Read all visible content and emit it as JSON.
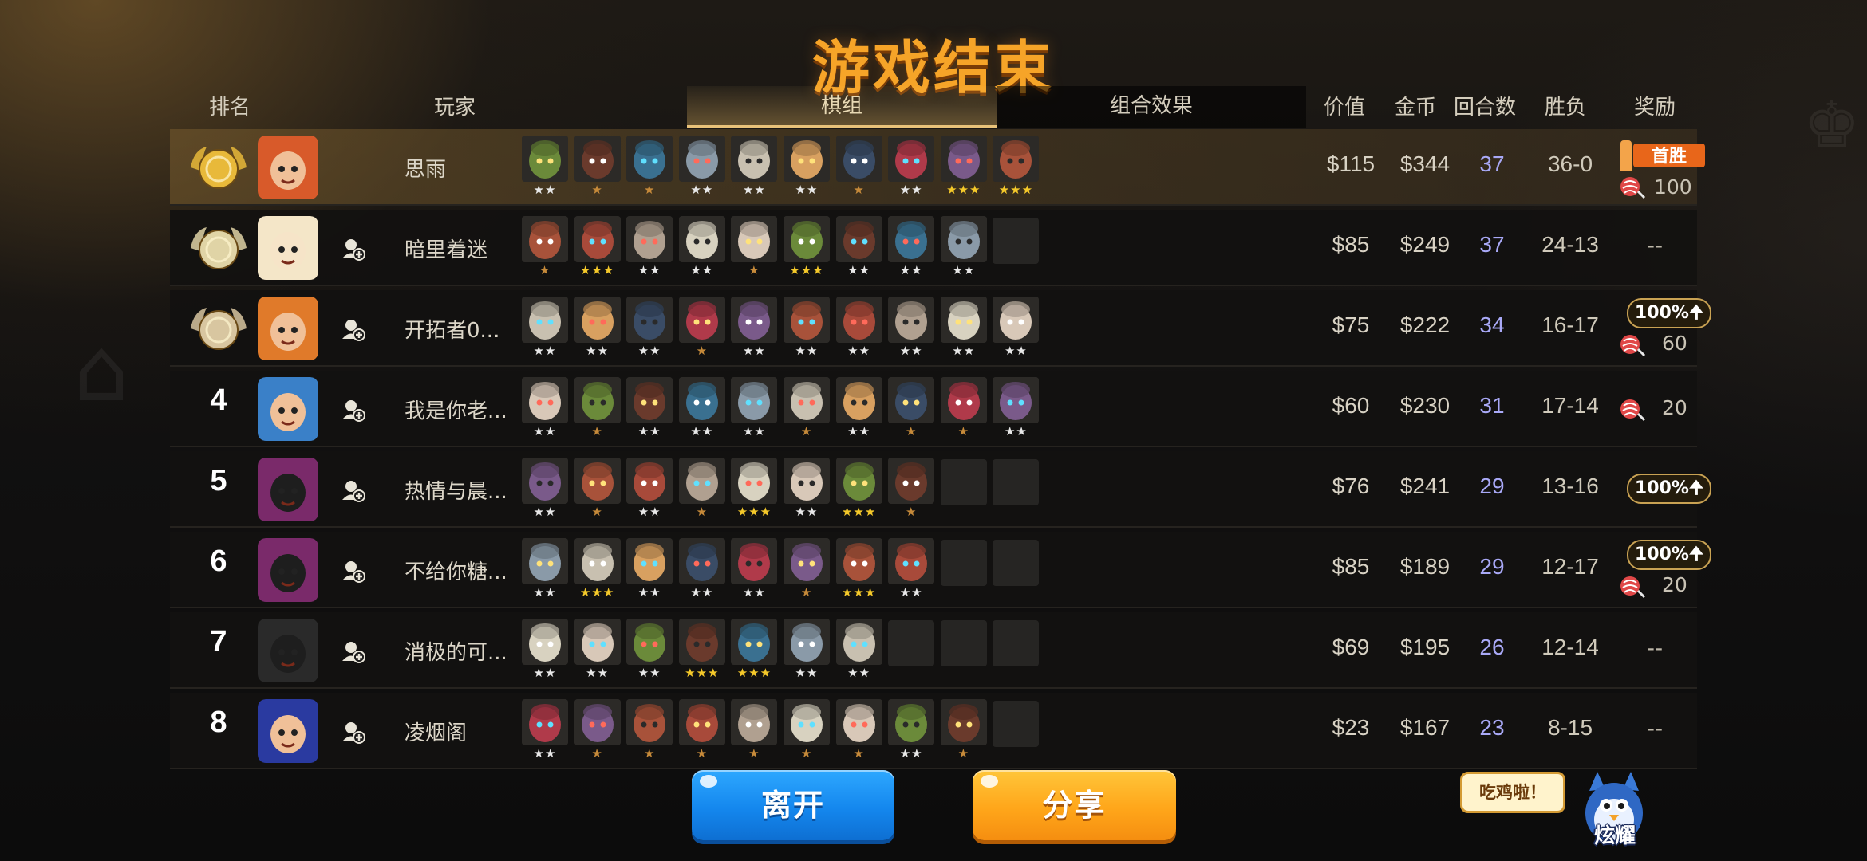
{
  "title": "游戏结束",
  "headers": {
    "rank": "排名",
    "player": "玩家",
    "lineup_tab": "棋组",
    "synergy_tab": "组合效果",
    "value": "价值",
    "gold": "金币",
    "rounds": "回合数",
    "win_loss": "胜负",
    "reward": "奖励"
  },
  "rows": [
    {
      "rank": "1",
      "rank_badge": "gold-medal",
      "name": "思雨",
      "value": "$115",
      "gold": "$344",
      "rounds": "37",
      "wl": "36-0",
      "reward": {
        "banner": "首胜",
        "candy": "100"
      },
      "stars": [
        2,
        1,
        1,
        2,
        2,
        2,
        1,
        2,
        3,
        3
      ],
      "units": 10
    },
    {
      "rank": "2",
      "rank_badge": "silver-medal",
      "name": "暗里着迷",
      "value": "$85",
      "gold": "$249",
      "rounds": "37",
      "wl": "24-13",
      "reward": {
        "dash": "--"
      },
      "stars": [
        1,
        3,
        2,
        2,
        1,
        3,
        2,
        2,
        2
      ],
      "units": 9
    },
    {
      "rank": "3",
      "rank_badge": "bronze-medal",
      "name": "开拓者0...",
      "value": "$75",
      "gold": "$222",
      "rounds": "34",
      "wl": "16-17",
      "reward": {
        "pill": "100%",
        "candy": "60"
      },
      "stars": [
        2,
        2,
        2,
        1,
        2,
        2,
        2,
        2,
        2,
        2
      ],
      "units": 10
    },
    {
      "rank": "4",
      "name": "我是你老...",
      "value": "$60",
      "gold": "$230",
      "rounds": "31",
      "wl": "17-14",
      "reward": {
        "candy": "20"
      },
      "stars": [
        2,
        1,
        2,
        2,
        2,
        1,
        2,
        1,
        1,
        2
      ],
      "units": 10
    },
    {
      "rank": "5",
      "name": "热情与晨...",
      "value": "$76",
      "gold": "$241",
      "rounds": "29",
      "wl": "13-16",
      "reward": {
        "pill": "100%"
      },
      "stars": [
        2,
        1,
        2,
        1,
        3,
        2,
        3,
        1
      ],
      "units": 8
    },
    {
      "rank": "6",
      "name": "不给你糖...",
      "value": "$85",
      "gold": "$189",
      "rounds": "29",
      "wl": "12-17",
      "reward": {
        "pill": "100%",
        "candy": "20"
      },
      "stars": [
        2,
        3,
        2,
        2,
        2,
        1,
        3,
        2
      ],
      "units": 8
    },
    {
      "rank": "7",
      "name": "消极的可...",
      "value": "$69",
      "gold": "$195",
      "rounds": "26",
      "wl": "12-14",
      "reward": {
        "dash": "--"
      },
      "stars": [
        2,
        2,
        2,
        3,
        3,
        2,
        2
      ],
      "units": 7
    },
    {
      "rank": "8",
      "name": "凌烟阁",
      "value": "$23",
      "gold": "$167",
      "rounds": "23",
      "wl": "8-15",
      "reward": {
        "dash": "--"
      },
      "stars": [
        2,
        1,
        1,
        1,
        1,
        1,
        1,
        2,
        1
      ],
      "units": 9
    }
  ],
  "buttons": {
    "leave": "离开",
    "share": "分享"
  },
  "flaunt": {
    "bubble": "吃鸡啦！",
    "label": "炫耀"
  },
  "colors": {
    "title": "#f6a428",
    "rounds": "#a9a9f7",
    "leave": "#1487ee",
    "share": "#ffa61a"
  }
}
